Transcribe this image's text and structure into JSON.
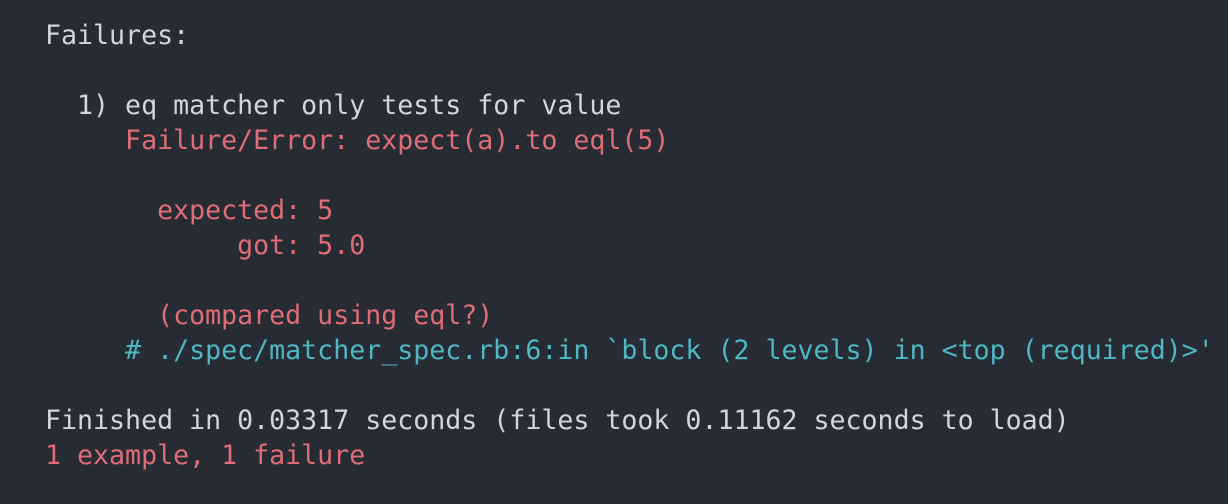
{
  "colors": {
    "background": "#272b33",
    "foreground": "#d2d5da",
    "failure": "#e06c75",
    "backtrace": "#4fb6c4"
  },
  "output": {
    "failures_header": "Failures:",
    "failure_title": "  1) eq matcher only tests for value",
    "failure_error": "     Failure/Error: expect(a).to eql(5)",
    "expected_line": "       expected: 5",
    "got_line": "            got: 5.0",
    "compared_line": "       (compared using eql?)",
    "backtrace_line": "     # ./spec/matcher_spec.rb:6:in `block (2 levels) in <top (required)>'",
    "finished_line": "Finished in 0.03317 seconds (files took 0.11162 seconds to load)",
    "summary_line": "1 example, 1 failure"
  }
}
